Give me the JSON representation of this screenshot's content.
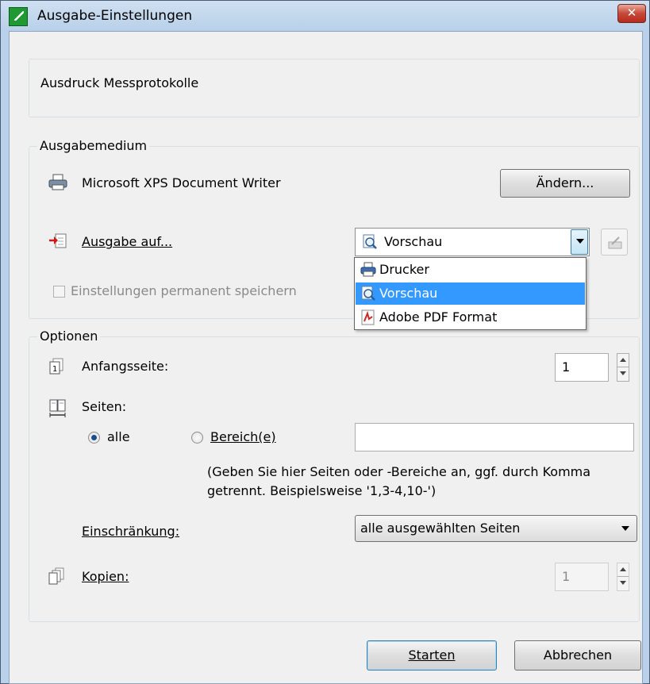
{
  "window": {
    "title": "Ausgabe-Einstellungen",
    "close_label": "✕"
  },
  "header": {
    "text": "Ausdruck Messprotokolle"
  },
  "ausgabemedium": {
    "legend": "Ausgabemedium",
    "printer_name": "Microsoft XPS Document Writer",
    "change_button": "Ändern...",
    "output_label": "Ausgabe auf...",
    "output_selected": "Vorschau",
    "output_options": [
      "Drucker",
      "Vorschau",
      "Adobe PDF Format"
    ],
    "save_settings_label": "Einstellungen permanent speichern"
  },
  "optionen": {
    "legend": "Optionen",
    "start_page_label": "Anfangsseite:",
    "start_page_value": "1",
    "pages_label": "Seiten:",
    "radio_all": "alle",
    "radio_range": "Bereich(e)",
    "range_value": "",
    "hint_line1": "(Geben Sie hier Seiten oder -Bereiche an, ggf. durch Komma",
    "hint_line2": "getrennt. Beispielsweise '1,3-4,10-')",
    "restriction_label": "Einschränkung:",
    "restriction_value": "alle ausgewählten Seiten",
    "copies_label": "Kopien:",
    "copies_value": "1"
  },
  "footer": {
    "start_button": "Starten",
    "cancel_button": "Abbrechen"
  }
}
